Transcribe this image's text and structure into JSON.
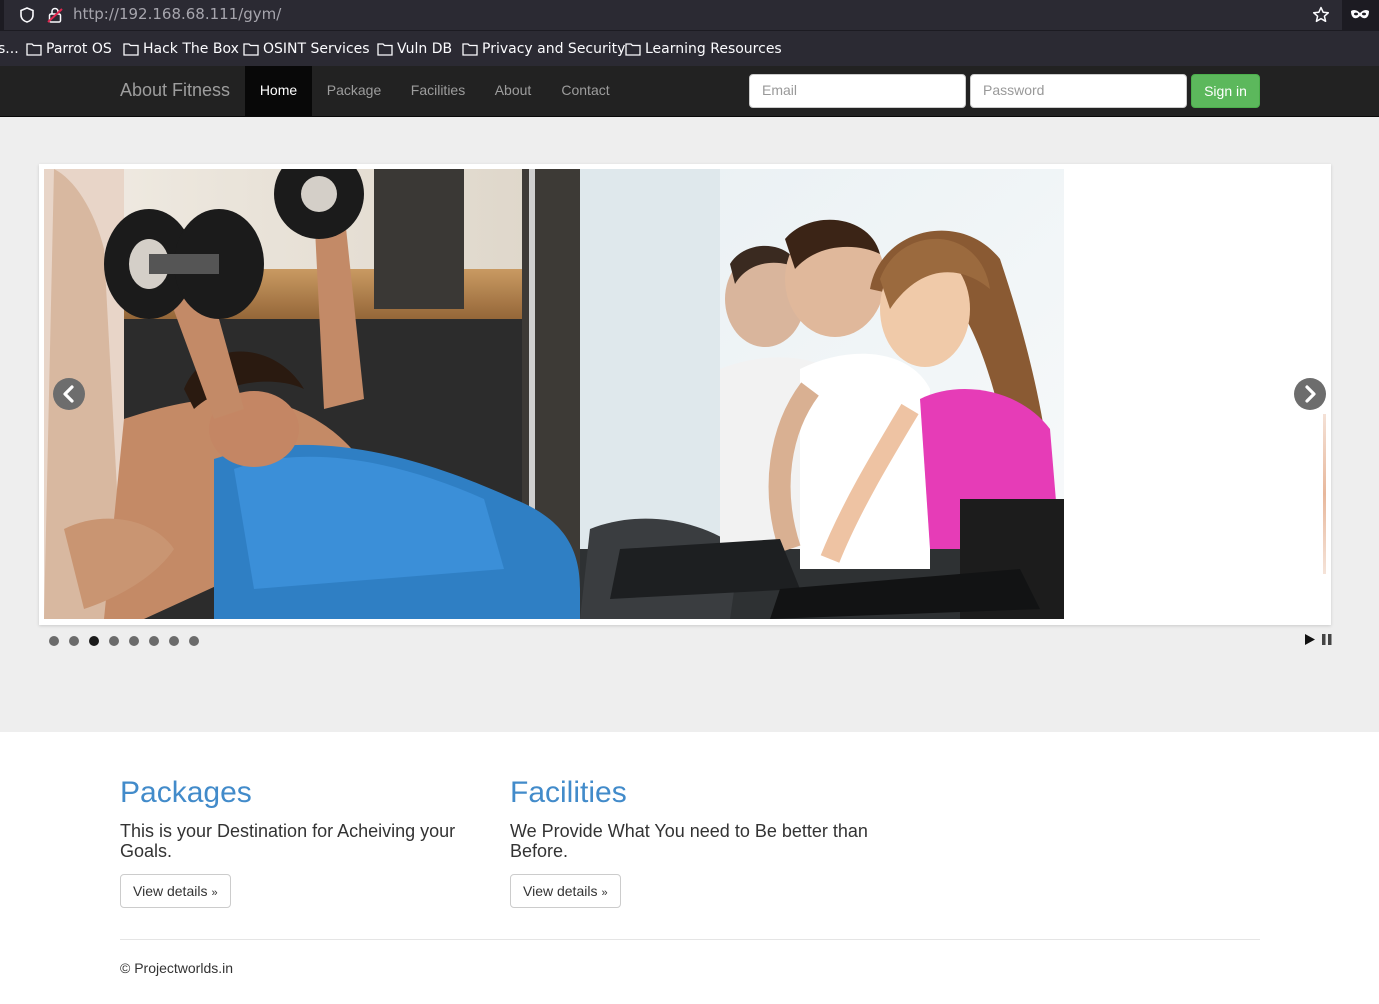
{
  "browser": {
    "url_host": "http://192.168.68.111",
    "url_path": "/gym/",
    "bookmarks": [
      {
        "label": "s..."
      },
      {
        "label": "Parrot OS"
      },
      {
        "label": "Hack The Box"
      },
      {
        "label": "OSINT Services"
      },
      {
        "label": "Vuln DB"
      },
      {
        "label": "Privacy and Security"
      },
      {
        "label": "Learning Resources"
      }
    ]
  },
  "navbar": {
    "brand": "About Fitness",
    "items": [
      {
        "label": "Home",
        "active": true
      },
      {
        "label": "Package"
      },
      {
        "label": "Facilities"
      },
      {
        "label": "About"
      },
      {
        "label": "Contact"
      }
    ],
    "email_placeholder": "Email",
    "password_placeholder": "Password",
    "signin_label": "Sign in"
  },
  "slider": {
    "dot_count": 8,
    "active_dot": 3
  },
  "sections": [
    {
      "title": "Packages",
      "text": "This is your Destination for Acheiving your Goals.",
      "button": "View details",
      "button_suffix": "»"
    },
    {
      "title": "Facilities",
      "text": "We Provide What You need to Be better than Before.",
      "button": "View details",
      "button_suffix": "»"
    }
  ],
  "footer": {
    "text": "© Projectworlds.in"
  },
  "colors": {
    "navbar_bg": "#222222",
    "signin_green": "#5cb85c",
    "heading_blue": "#428bca",
    "jumbotron_bg": "#eeeeee"
  }
}
